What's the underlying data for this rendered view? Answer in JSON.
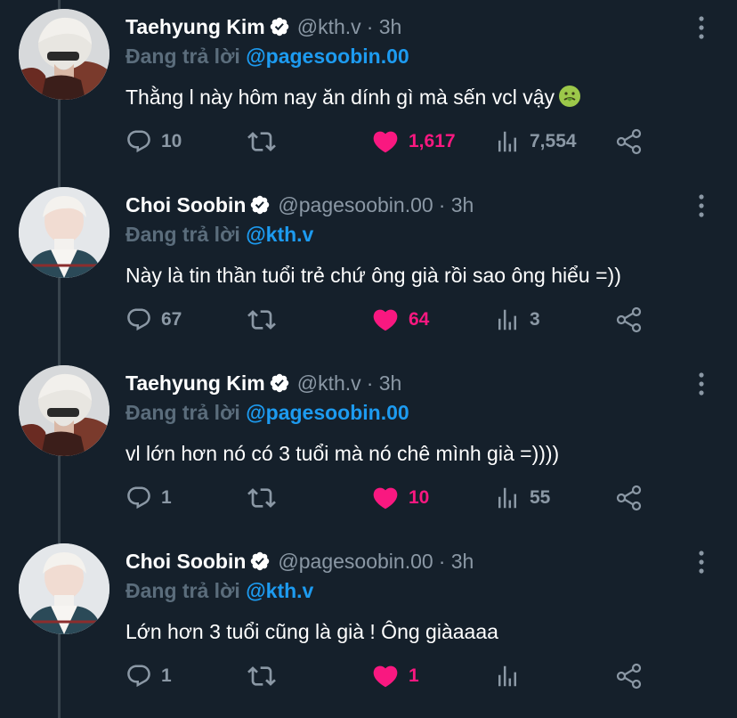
{
  "tweets": [
    {
      "name": "Taehyung Kim",
      "handle": "@kth.v",
      "time": "· 3h",
      "reply_prefix": "Đang trả lời ",
      "reply_to": "@pagesoobin.00",
      "text": "Thằng l này hôm nay ăn dính gì mà sến vcl vậy",
      "emoji": "nauseated-face",
      "replies": "10",
      "retweets": "",
      "likes": "1,617",
      "views": "7,554",
      "avatar": "taehyung-avatar"
    },
    {
      "name": "Choi Soobin",
      "handle": "@pagesoobin.00",
      "time": "· 3h",
      "reply_prefix": "Đang trả lời ",
      "reply_to": "@kth.v",
      "text": "Này là tin thần tuổi trẻ chứ ông già rồi sao ông hiểu =))",
      "replies": "67",
      "retweets": "",
      "likes": "64",
      "views": "3",
      "avatar": "soobin-avatar"
    },
    {
      "name": "Taehyung Kim",
      "handle": "@kth.v",
      "time": "· 3h",
      "reply_prefix": "Đang trả lời ",
      "reply_to": "@pagesoobin.00",
      "text": "vl lớn hơn nó có 3 tuổi mà nó chê mình già =))))",
      "replies": "1",
      "retweets": "",
      "likes": "10",
      "views": "55",
      "avatar": "taehyung-avatar"
    },
    {
      "name": "Choi Soobin",
      "handle": "@pagesoobin.00",
      "time": "· 3h",
      "reply_prefix": "Đang trả lời ",
      "reply_to": "@kth.v",
      "text": "Lớn hơn 3 tuổi cũng là già ! Ông giàaaaa",
      "replies": "1",
      "retweets": "",
      "likes": "1",
      "views": "",
      "avatar": "soobin-avatar"
    }
  ],
  "colors": {
    "background": "#15202b",
    "like": "#f91880",
    "mention": "#1d9bf0",
    "muted": "#8b98a5",
    "verified": "#ffffff"
  }
}
